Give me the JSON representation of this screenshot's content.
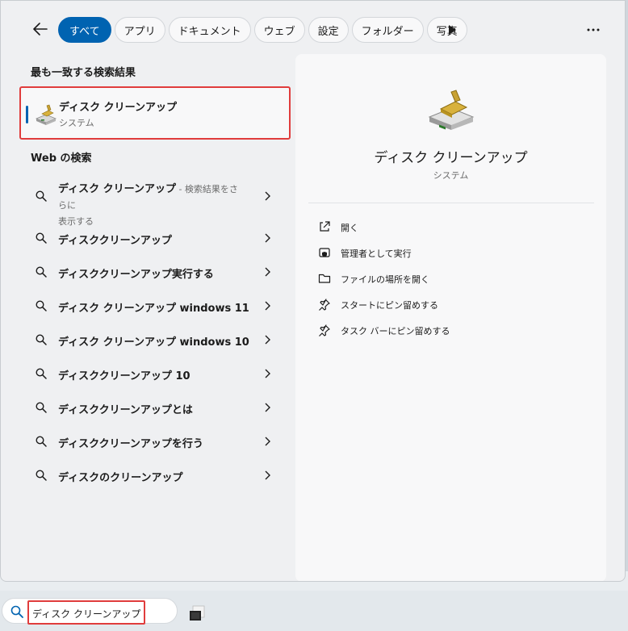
{
  "filters": {
    "items": [
      "すべて",
      "アプリ",
      "ドキュメント",
      "ウェブ",
      "設定",
      "フォルダー",
      "写真"
    ],
    "active_index": 0
  },
  "best_match": {
    "section_title": "最も一致する検索結果",
    "name": "ディスク クリーンアップ",
    "type": "システム"
  },
  "web_search": {
    "section_title": "Web の検索",
    "first": {
      "query": "ディスク クリーンアップ",
      "hint_line1": " - 検索結果をさらに",
      "hint_line2": "表示する"
    },
    "items": [
      "ディスククリーンアップ",
      "ディスククリーンアップ実行する",
      "ディスク クリーンアップ windows 11",
      "ディスク クリーンアップ windows 10",
      "ディスククリーンアップ 10",
      "ディスククリーンアップとは",
      "ディスククリーンアップを行う",
      "ディスクのクリーンアップ"
    ]
  },
  "detail": {
    "title": "ディスク クリーンアップ",
    "subtitle": "システム",
    "actions": [
      {
        "label": "開く",
        "icon": "open-external-icon"
      },
      {
        "label": "管理者として実行",
        "icon": "shield-admin-icon"
      },
      {
        "label": "ファイルの場所を開く",
        "icon": "folder-icon"
      },
      {
        "label": "スタートにピン留めする",
        "icon": "pin-icon"
      },
      {
        "label": "タスク バーにピン留めする",
        "icon": "pin-icon"
      }
    ]
  },
  "taskbar": {
    "search_value": "ディスク クリーンアップ"
  },
  "colors": {
    "accent": "#0063b1",
    "highlight": "#e03c3c"
  }
}
